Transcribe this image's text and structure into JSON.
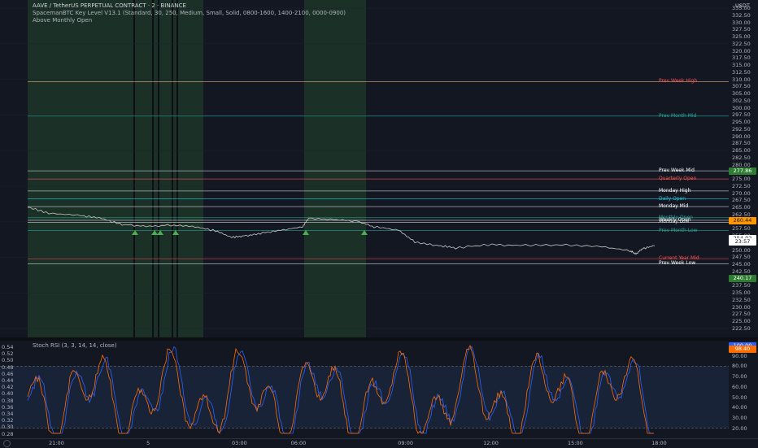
{
  "header": {
    "title": "AAVE / TetherUS PERPETUAL CONTRACT · 2 · BINANCE",
    "indicator": "SpacemanBTC Key Level V13.1 (Standard, 30, 250, Medium, Small, Solid, 0800-1600, 1400-2100, 0000-0900)",
    "status": "Above Monthly Open"
  },
  "price_axis": {
    "currency": "USDT",
    "ticks": [
      "335.00",
      "332.50",
      "330.00",
      "327.50",
      "325.00",
      "322.50",
      "320.00",
      "317.50",
      "315.00",
      "312.50",
      "310.00",
      "307.50",
      "305.00",
      "302.50",
      "300.00",
      "297.50",
      "295.00",
      "292.50",
      "290.00",
      "287.50",
      "285.00",
      "282.50",
      "280.00",
      "277.50",
      "275.00",
      "272.50",
      "270.00",
      "267.50",
      "265.00",
      "262.50",
      "260.00",
      "257.50",
      "255.00",
      "252.50",
      "250.00",
      "247.50",
      "245.00",
      "242.50",
      "240.00",
      "237.50",
      "235.00",
      "232.50",
      "230.00",
      "227.50",
      "225.00",
      "222.50"
    ],
    "badges": [
      {
        "label": "277.86",
        "bg": "#2e7d32",
        "fg": "#ffffff",
        "price": 277.86
      },
      {
        "label": "260.44",
        "bg": "#ff9800",
        "fg": "#131722",
        "price": 260.44
      },
      {
        "label": "254.02",
        "bg": "#ffffff",
        "fg": "#131722",
        "price": 254.02
      },
      {
        "label": "23:57",
        "bg": "#ffffff",
        "fg": "#131722",
        "price": 252.9
      },
      {
        "label": "240.17",
        "bg": "#2e7d32",
        "fg": "#ffffff",
        "price": 240.17
      }
    ]
  },
  "levels": [
    {
      "label": "Prev Week High",
      "price": 309.2,
      "color": "#f0b27a",
      "text": "#ff5252"
    },
    {
      "label": "Prev Month Mid",
      "price": 297.1,
      "color": "#26a69a",
      "text": "#26a69a"
    },
    {
      "label": "Prev Week Mid",
      "price": 277.86,
      "color": "#d1d4dc",
      "text": "#ffffff"
    },
    {
      "label": "Quarterly Open",
      "price": 275.0,
      "color": "#ff5252",
      "text": "#ff5252"
    },
    {
      "label": "Monday High",
      "price": 270.8,
      "color": "#d1d4dc",
      "text": "#ffffff"
    },
    {
      "label": "Daily Open",
      "price": 268.0,
      "color": "#26c6da",
      "text": "#26c6da"
    },
    {
      "label": "Monday Mid",
      "price": 265.3,
      "color": "#d1d4dc",
      "text": "#ffffff"
    },
    {
      "label": "Monthly Open",
      "price": 261.4,
      "color": "#26a69a",
      "text": "#26a69a"
    },
    {
      "label": "Weekly Open",
      "price": 260.5,
      "color": "#ffffff",
      "text": "#ffffff"
    },
    {
      "label": "Monday Low",
      "price": 259.8,
      "color": "#d1d4dc",
      "text": "#d1d4dc"
    },
    {
      "label": "Prev Month Low",
      "price": 256.9,
      "color": "#26a69a",
      "text": "#26a69a"
    },
    {
      "label": "Current Year Mid",
      "price": 247.0,
      "color": "#ff5252",
      "text": "#ff5252"
    },
    {
      "label": "Prev Week Low",
      "price": 245.2,
      "color": "#d1d4dc",
      "text": "#ffffff"
    }
  ],
  "rsi": {
    "title": "Stoch RSI (3, 3, 14, 14, close)",
    "left_ticks": [
      "0.54",
      "0.52",
      "0.50",
      "0.48",
      "0.46",
      "0.44",
      "0.42",
      "0.40",
      "0.38",
      "0.36",
      "0.34",
      "0.32",
      "0.30",
      "0.28"
    ],
    "right_ticks": [
      "100.00",
      "90.00",
      "80.00",
      "70.00",
      "60.00",
      "50.00",
      "40.00",
      "30.00",
      "20.00"
    ],
    "badges": [
      {
        "label": "100.00",
        "bg": "#2962ff",
        "fg": "#ffffff",
        "value": 100
      },
      {
        "label": "98.40",
        "bg": "#ff6d00",
        "fg": "#ffffff",
        "value": 96.5
      }
    ],
    "upper_band": 80,
    "lower_band": 20,
    "k_color": "#2962ff",
    "d_color": "#ff6d00"
  },
  "time_axis": {
    "ticks": [
      {
        "label": "21:00",
        "pos": 0.076
      },
      {
        "label": "5",
        "pos": 0.21
      },
      {
        "label": "03:00",
        "pos": 0.327
      },
      {
        "label": "06:00",
        "pos": 0.408
      },
      {
        "label": "09:00",
        "pos": 0.555
      },
      {
        "label": "12:00",
        "pos": 0.672
      },
      {
        "label": "15:00",
        "pos": 0.788
      },
      {
        "label": "18:00",
        "pos": 0.903
      }
    ]
  },
  "colors": {
    "session_fill": "#1f3a28",
    "price_line": "#c8c8c8",
    "arrow": "#4caf50"
  }
}
